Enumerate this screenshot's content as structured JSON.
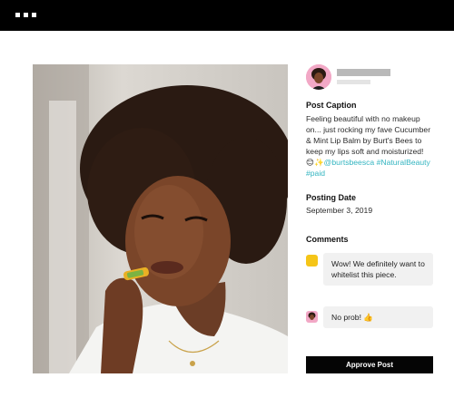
{
  "post": {
    "caption_heading": "Post Caption",
    "caption_text": "Feeling beautiful with no makeup on... just rocking my fave Cucumber & Mint Lip Balm by Burt's Bees to keep my lips soft and moisturized!",
    "caption_emoji": "😊✨",
    "caption_mention": "@burtsbeesca",
    "caption_hashtag_1": "#NaturalBeauty",
    "caption_hashtag_2": "#paid",
    "date_heading": "Posting Date",
    "date_value": "September 3, 2019"
  },
  "comments": {
    "heading": "Comments",
    "items": [
      {
        "text": "Wow! We definitely want to whitelist this piece.",
        "icon": "brand-square-icon",
        "icon_color": "#f5c518"
      },
      {
        "text": "No prob! 👍",
        "icon": "creator-avatar-icon",
        "icon_color": "#f2a8c6"
      }
    ]
  },
  "actions": {
    "approve_label": "Approve Post"
  },
  "colors": {
    "topbar": "#000000",
    "accent_link": "#34b5c1",
    "button": "#050505"
  }
}
